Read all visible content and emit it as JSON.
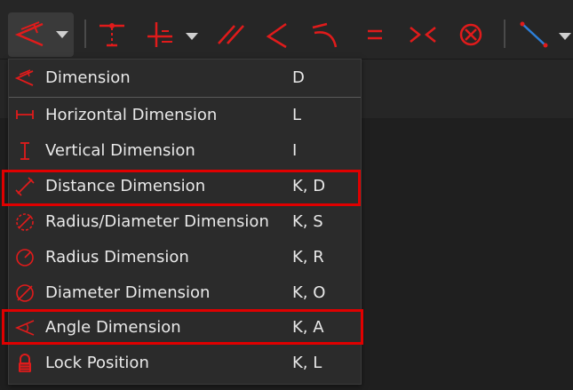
{
  "toolbar": {
    "buttons": [
      {
        "name": "dimension-dropdown",
        "icon": "dimension-icon",
        "active": true
      },
      {
        "name": "horizontal-distance",
        "icon": "horizontal-distance-icon"
      },
      {
        "name": "vertical-constraint",
        "icon": "vertical-constraint-icon"
      },
      {
        "name": "parallel",
        "icon": "parallel-icon"
      },
      {
        "name": "perpendicular",
        "icon": "perpendicular-icon"
      },
      {
        "name": "tangent",
        "icon": "tangent-icon"
      },
      {
        "name": "equal",
        "icon": "equal-icon"
      },
      {
        "name": "symmetric",
        "icon": "symmetric-icon"
      },
      {
        "name": "block",
        "icon": "block-icon"
      },
      {
        "name": "toggle-construction",
        "icon": "construction-line-icon"
      }
    ]
  },
  "menu": {
    "items": [
      {
        "label": "Dimension",
        "shortcut": "D",
        "icon": "dimension-icon"
      },
      {
        "label": "Horizontal Dimension",
        "shortcut": "L",
        "icon": "horizontal-dimension-icon"
      },
      {
        "label": "Vertical Dimension",
        "shortcut": "I",
        "icon": "vertical-dimension-icon"
      },
      {
        "label": "Distance Dimension",
        "shortcut": "K, D",
        "icon": "distance-dimension-icon",
        "highlighted": true
      },
      {
        "label": "Radius/Diameter Dimension",
        "shortcut": "K, S",
        "icon": "radius-diameter-icon"
      },
      {
        "label": "Radius Dimension",
        "shortcut": "K, R",
        "icon": "radius-icon"
      },
      {
        "label": "Diameter Dimension",
        "shortcut": "K, O",
        "icon": "diameter-icon"
      },
      {
        "label": "Angle Dimension",
        "shortcut": "K, A",
        "icon": "angle-icon",
        "highlighted": true
      },
      {
        "label": "Lock Position",
        "shortcut": "K, L",
        "icon": "lock-icon"
      }
    ]
  },
  "colors": {
    "icon_red": "#e01b1b",
    "highlight_red": "#e00000",
    "icon_blue": "#2d7fd8",
    "background": "#1f1f1f",
    "menu_bg": "#2b2b2b"
  }
}
